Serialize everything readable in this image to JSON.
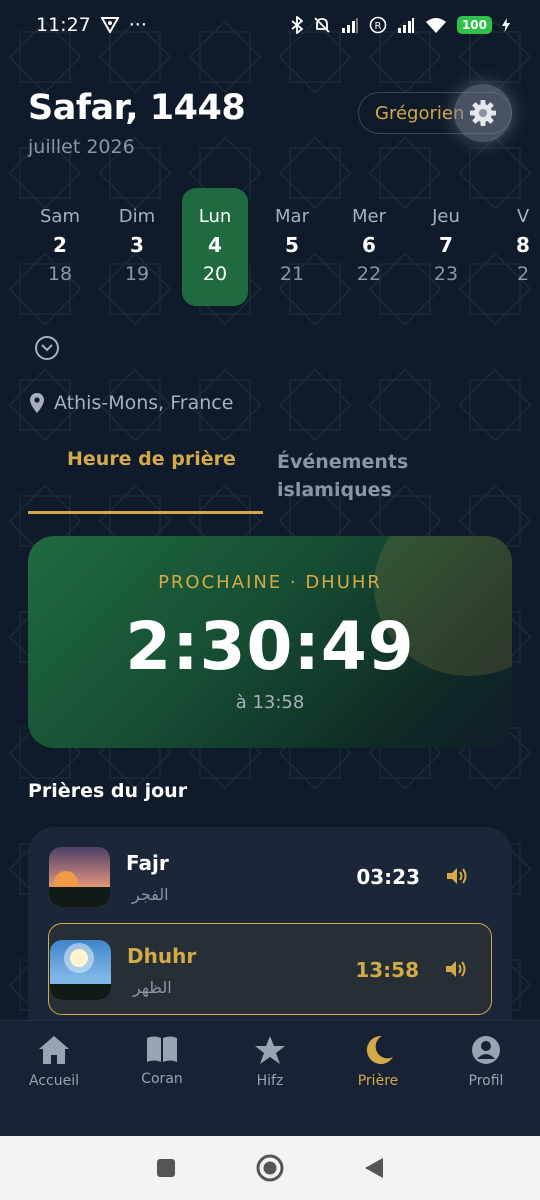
{
  "status_bar": {
    "time": "11:27",
    "dots": "···",
    "battery": "100"
  },
  "header": {
    "hijri_title": "Safar, 1448",
    "gregorian_month": "juillet 2026",
    "calendar_toggle": "Grégorien"
  },
  "days": [
    {
      "name": "Sam",
      "hijri": "2",
      "greg": "18",
      "active": false
    },
    {
      "name": "Dim",
      "hijri": "3",
      "greg": "19",
      "active": false
    },
    {
      "name": "Lun",
      "hijri": "4",
      "greg": "20",
      "active": true
    },
    {
      "name": "Mar",
      "hijri": "5",
      "greg": "21",
      "active": false
    },
    {
      "name": "Mer",
      "hijri": "6",
      "greg": "22",
      "active": false
    },
    {
      "name": "Jeu",
      "hijri": "7",
      "greg": "23",
      "active": false
    },
    {
      "name": "V",
      "hijri": "8",
      "greg": "2",
      "active": false
    }
  ],
  "location": "Athis-Mons, France",
  "tabs": {
    "prayer_times": "Heure de prière",
    "events_line1": "Événements",
    "events_line2": "islamiques"
  },
  "next_prayer": {
    "label": "PROCHAINE · DHUHR",
    "countdown": "2:30:49",
    "at": "à 13:58"
  },
  "section_title": "Prières du jour",
  "prayers": [
    {
      "name": "Fajr",
      "arabic": "الفجر",
      "time": "03:23",
      "active": false
    },
    {
      "name": "Dhuhr",
      "arabic": "الظهر",
      "time": "13:58",
      "active": true
    }
  ],
  "nav": [
    {
      "label": "Accueil",
      "icon": "home-icon"
    },
    {
      "label": "Coran",
      "icon": "book-icon"
    },
    {
      "label": "Hifz",
      "icon": "star-icon"
    },
    {
      "label": "Prière",
      "icon": "moon-icon"
    },
    {
      "label": "Profil",
      "icon": "profile-icon"
    }
  ],
  "colors": {
    "accent": "#d4a94a",
    "active_green": "#1f6b3f",
    "background": "#0f1a2a"
  }
}
